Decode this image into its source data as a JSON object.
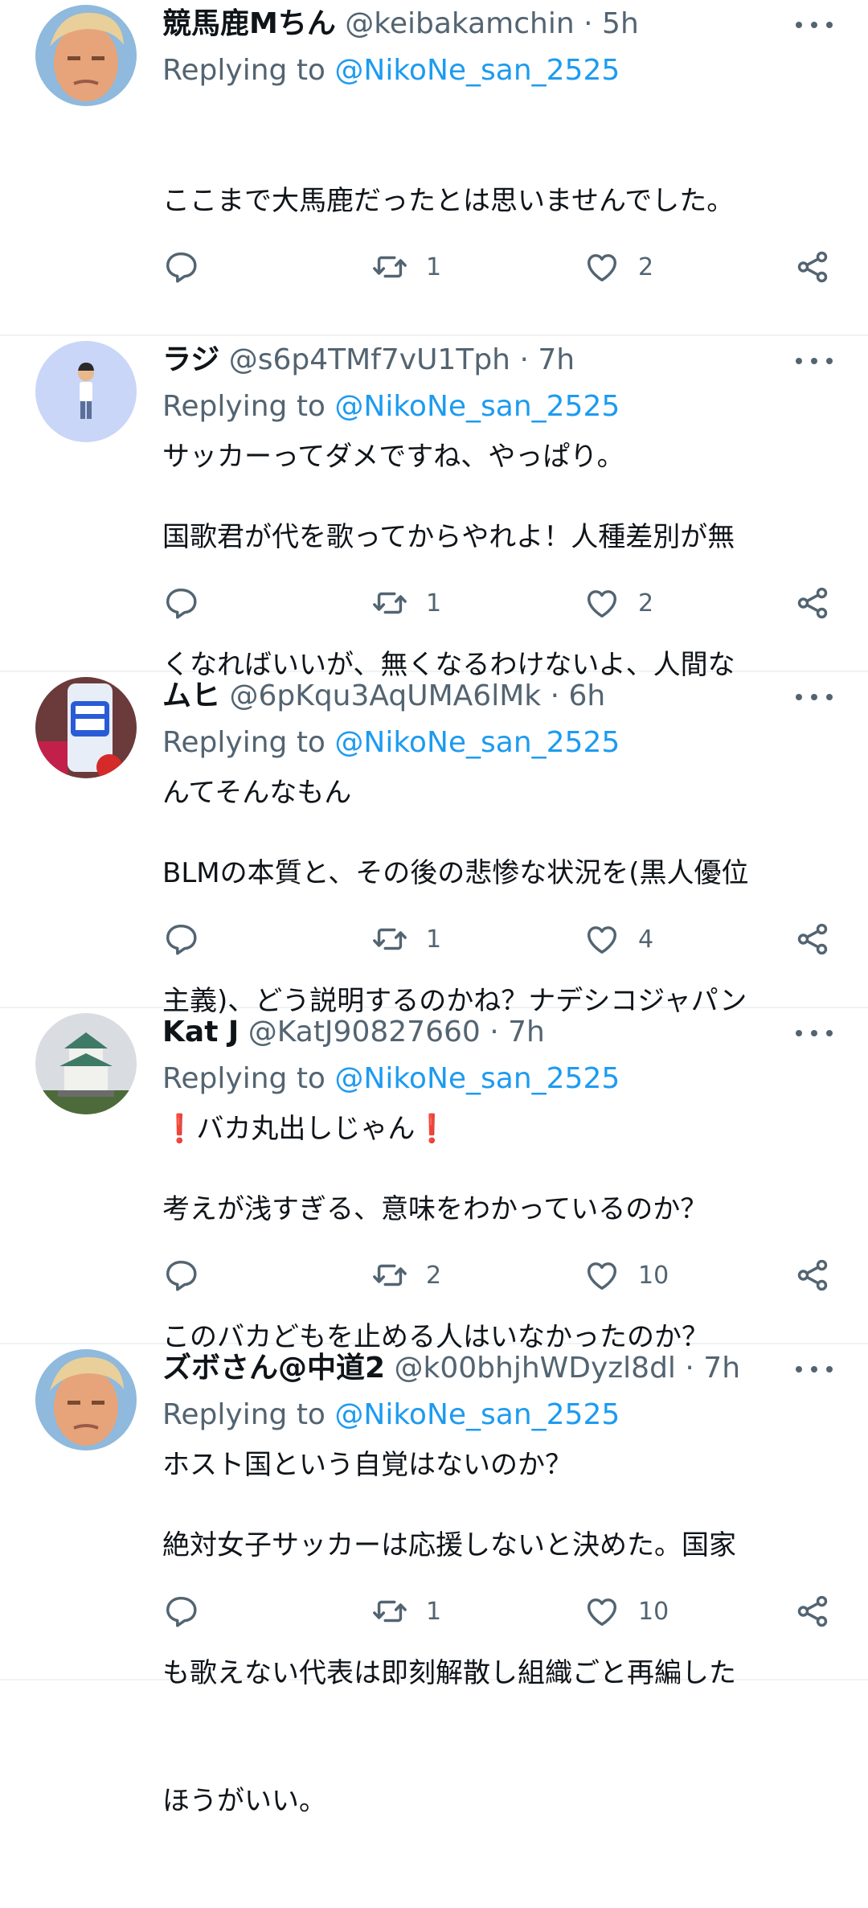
{
  "tweets": [
    {
      "name": "競馬鹿Mちん",
      "handle": "@keibakamchin",
      "time": "5h",
      "replying_label": "Replying to",
      "replying_to": "@NikoNe_san_2525",
      "lines": [
        "ここまで大馬鹿だったとは思いませんでした。",
        "",
        "サッカーってダメですね、やっぱり。"
      ],
      "retweets": "1",
      "likes": "2",
      "avatar": "trump-portrait"
    },
    {
      "name": "ラジ",
      "handle": "@s6p4TMf7vU1Tph",
      "time": "7h",
      "replying_label": "Replying to",
      "replying_to": "@NikoNe_san_2525",
      "lines": [
        "国歌君が代を歌ってからやれよ！人種差別が無",
        "くなればいいが、無くなるわけないよ、人間な",
        "んてそんなもん"
      ],
      "retweets": "1",
      "likes": "2",
      "avatar": "standing-person"
    },
    {
      "name": "ムヒ",
      "handle": "@6pKqu3AqUMA6lMk",
      "time": "6h",
      "replying_label": "Replying to",
      "replying_to": "@NikoNe_san_2525",
      "lines": [
        "BLMの本質と、その後の悲惨な状況を(黒人優位",
        "主義)、どう説明するのかね？ナデシコジャパン",
        "❗バカ丸出しじゃん❗"
      ],
      "retweets": "1",
      "likes": "4",
      "avatar": "muhi-bottle"
    },
    {
      "name": "Kat J",
      "handle": "@KatJ90827660",
      "time": "7h",
      "replying_label": "Replying to",
      "replying_to": "@NikoNe_san_2525",
      "lines": [
        "考えが浅すぎる、意味をわかっているのか？",
        "このバカどもを止める人はいなかったのか？",
        "ホスト国という自覚はないのか？"
      ],
      "retweets": "2",
      "likes": "10",
      "avatar": "osaka-castle"
    },
    {
      "name": "ズボさん@中道2",
      "handle": "@k00bhjhWDyzl8dl",
      "time": "7h",
      "replying_label": "Replying to",
      "replying_to": "@NikoNe_san_2525",
      "lines": [
        "絶対女子サッカーは応援しないと決めた。国家",
        "も歌えない代表は即刻解散し組織ごと再編した",
        "ほうがいい。"
      ],
      "retweets": "1",
      "likes": "10",
      "avatar": "trump-portrait"
    }
  ],
  "colors": {
    "text": "#0f1419",
    "secondary": "#536471",
    "link": "#1d9bf0",
    "divider": "#eff3f4"
  }
}
